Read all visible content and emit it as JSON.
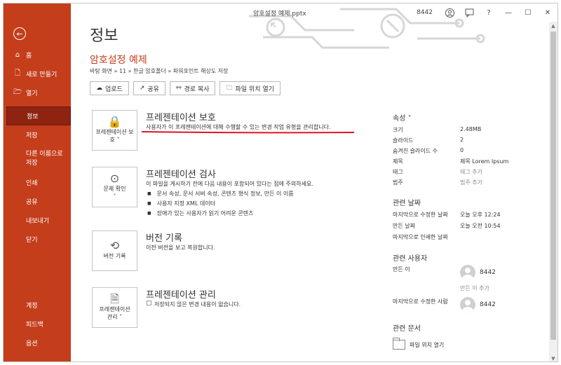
{
  "window": {
    "title": "암호설정 예제.pptx",
    "user": "8442",
    "controls": [
      "?",
      "—",
      "☐",
      "✕"
    ]
  },
  "sidebar": {
    "back_icon": "back-arrow-icon",
    "top_items": [
      {
        "icon": "⌂",
        "label": "홈"
      },
      {
        "icon": "🗋",
        "label": "새로 만들기"
      },
      {
        "icon": "🗁",
        "label": "열기"
      }
    ],
    "items": [
      {
        "label": "정보",
        "active": true
      },
      {
        "label": "저장"
      },
      {
        "label": "다른 이름으로 저장"
      },
      {
        "label": "인쇄"
      },
      {
        "label": "공유"
      },
      {
        "label": "내보내기"
      },
      {
        "label": "닫기"
      }
    ],
    "bottom_items": [
      {
        "label": "계정"
      },
      {
        "label": "피드백"
      },
      {
        "label": "옵션"
      }
    ]
  },
  "main": {
    "title": "정보",
    "doc_name": "암호설정 예제",
    "path": "바탕 화면 » 11 » 한글 암호폴더 » 파워포인트 해상도 저장",
    "actions": [
      {
        "icon": "☁",
        "label": "업로드"
      },
      {
        "icon": "↗",
        "label": "공유"
      },
      {
        "icon": "⚯",
        "label": "경로 복사"
      },
      {
        "icon": "🗀",
        "label": "파일 위치 열기"
      }
    ],
    "sections": [
      {
        "box_label": "프레젠테이션 보호 ˅",
        "icon": "🔒",
        "title": "프레젠테이션 보호",
        "desc": "사용자가 이 프레젠테이션에 대해 수행할 수 있는 변경 작업 유형을 관리합니다."
      },
      {
        "box_label": "문제 확인 ˅",
        "icon": "⊙",
        "title": "프레젠테이션 검사",
        "desc": "이 파일을 게시하기 전에 다음 내용이 포함되어 있다는 점에 주의하세요.",
        "bullets": [
          "문서 속성, 문서 서버 속성, 콘텐츠 형식 정보, 만든 이 이름",
          "사용자 지정 XML 데이터",
          "장애가 있는 사용자가 읽기 어려운 콘텐츠"
        ]
      },
      {
        "box_label": "버전 기록",
        "icon": "⟲",
        "title": "버전 기록",
        "desc": "이전 버전을 보고 복원합니다."
      },
      {
        "box_label": "프레젠테이션 관리 ˅",
        "icon": "🗎",
        "title": "프레젠테이션 관리",
        "desc": "저장되지 않은 변경 내용이 없습니다."
      }
    ]
  },
  "properties": {
    "head": "속성 ˅",
    "rows": [
      {
        "k": "크기",
        "v": "2.48MB"
      },
      {
        "k": "슬라이드",
        "v": "2"
      },
      {
        "k": "숨겨진 슬라이드 수",
        "v": "0"
      },
      {
        "k": "제목",
        "v": "제목 Lorem Ipsum"
      },
      {
        "k": "태그",
        "v": "태그 추가",
        "muted": true
      },
      {
        "k": "범주",
        "v": "범주 추가",
        "muted": true
      }
    ],
    "dates_head": "관련 날짜",
    "dates": [
      {
        "k": "마지막으로 수정한 날짜",
        "v": "오늘 오후 12:24"
      },
      {
        "k": "만든 날짜",
        "v": "오늘 오전 10:54"
      },
      {
        "k": "마지막으로 인쇄한 날짜",
        "v": ""
      }
    ],
    "people_head": "관련 사용자",
    "author_label": "만든 이",
    "author_name": "8442",
    "add_author": "만든 이 추가",
    "modifier_label": "마지막으로 수정한 사람",
    "modifier_name": "8442",
    "docs_head": "관련 문서",
    "open_location": "파일 위치 열기"
  },
  "colors": {
    "accent": "#c43e1c",
    "active": "#8e2312",
    "annotation": "#e0141e"
  }
}
